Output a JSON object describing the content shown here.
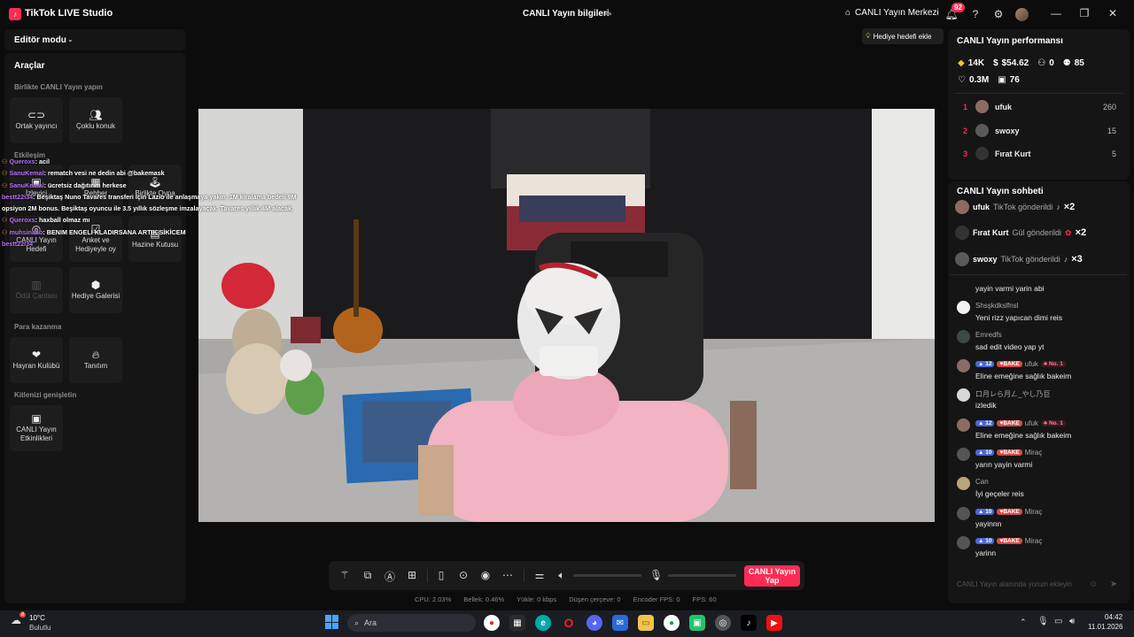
{
  "titlebar": {
    "app_name": "TikTok LIVE Studio",
    "center_title": "CANLI Yayın bilgileri",
    "hub_label": "CANLI Yayın Merkezi",
    "notification_count": "92"
  },
  "left": {
    "editor_mode": "Editör modu",
    "tools_title": "Araçlar",
    "sections": {
      "together": "Birlikte CANLI Yayın yapın",
      "engagement": "Etkileşim",
      "monetize": "Para kazanma",
      "audience": "Kitlenizi genişletin"
    },
    "together_tools": [
      "Ortak yayıncı",
      "Çoklu konuk"
    ],
    "engagement_tools": [
      "İzleyici",
      "Rehber",
      "Birlikte Oyna",
      "CANLI Yayın Hedefi",
      "Anket ve Hediyeyle oy",
      "Hazine Kutusu",
      "Ödül Çantası",
      "Hediye Galerisi"
    ],
    "monetize_tools": [
      "Hayran Kulübü",
      "Tanıtım"
    ],
    "audience_tools": [
      "CANLI Yayın Etkinlikleri"
    ]
  },
  "overlay_chat": [
    {
      "user": "Queroxs",
      "text": ": acil"
    },
    {
      "user": "SanuKemal",
      "text": ": rematch vesi ne dedin abi @bakemask"
    },
    {
      "user": "SanuKemal",
      "text": ": ücretsiz dağıtırım herkese"
    },
    {
      "user": "bestt22i34",
      "text": ": Beşiktaş Nuno Tavares transferi için Lazio ile anlaşmaya yakın. 1M kiralama bedeli 9M opsiyon 2M bonus. Beşiktaş oyuncu ile 3.5 yıllık sözleşme imzalayacak. Tavares yıllık 4M alacak."
    },
    {
      "user": "Queroxs",
      "text": ": haxball olmaz mı"
    },
    {
      "user": "muhsinakb",
      "text": ": BENIM ENGELI KLADIRSANA ARTIK SİKİCEM"
    },
    {
      "user": "bestt22i34",
      "text": ""
    }
  ],
  "goal_button": "Hediye hedefi ekle",
  "performance": {
    "title": "CANLI Yayın performansı",
    "diamonds": "14K",
    "earnings": "$54.62",
    "new_followers": "0",
    "viewers": "85",
    "likes": "0.3M",
    "gifters": "76",
    "ranking": [
      {
        "rank": "1",
        "name": "ufuk",
        "score": "260"
      },
      {
        "rank": "2",
        "name": "swoxy",
        "score": "15"
      },
      {
        "rank": "3",
        "name": "Fırat Kurt",
        "score": "5"
      }
    ]
  },
  "chat": {
    "title": "CANLI Yayın sohbeti",
    "gifts": [
      {
        "name": "ufuk",
        "text": "TikTok gönderildi",
        "mult": "×2"
      },
      {
        "name": "Fırat Kurt",
        "text": "Gül gönderildi",
        "mult": "×2"
      },
      {
        "name": "swoxy",
        "text": "TikTok gönderildi",
        "mult": "×3"
      }
    ],
    "partial_message": "yayin varmi yarin abi",
    "messages": [
      {
        "user": "Shsşkdkslfnsl",
        "text": "Yeni rizz yapıcan dimi reis"
      },
      {
        "user": "Emredfs",
        "text": "sad edit video yap yt"
      },
      {
        "level": "12",
        "fan": "BAKE",
        "user": "ufuk",
        "rank": "No. 1",
        "text": "Eline emeğine sağlık bakeim"
      },
      {
        "user": "口月レら月ㄥ_やし乃巨",
        "text": "izledik"
      },
      {
        "level": "12",
        "fan": "BAKE",
        "user": "ufuk",
        "rank": "No. 1",
        "text": "Eline emeğine sağlık bakeim"
      },
      {
        "level": "10",
        "fan": "BAKE",
        "user": "Miraç",
        "text": "yarın yayin varmi"
      },
      {
        "user": "Can",
        "text": "İyi geçeler reis"
      },
      {
        "level": "10",
        "fan": "BAKE",
        "user": "Miraç",
        "text": "yayinnn"
      },
      {
        "level": "10",
        "fan": "BAKE",
        "user": "Miraç",
        "text": "yarinn"
      }
    ],
    "input_placeholder": "CANLI Yayın alanında yorum ekleyin"
  },
  "controls": {
    "go_live": "CANLI Yayın Yap"
  },
  "stats": {
    "cpu": "CPU: 2.03%",
    "memory": "Bellek: 0.46%",
    "upload": "Yükle: 0 kbps",
    "dropped": "Düşen çerçeve: 0",
    "encoder_fps": "Encoder FPS: 0",
    "fps": "FPS: 60"
  },
  "taskbar": {
    "weather_badge": "8",
    "weather_temp": "10°C",
    "weather_desc": "Bulutlu",
    "search_placeholder": "Ara",
    "time": "04:42",
    "date": "11.01.2026"
  },
  "colors": {
    "accent": "#fe2c55",
    "panel": "#151515",
    "bg": "#0c0c0c"
  }
}
